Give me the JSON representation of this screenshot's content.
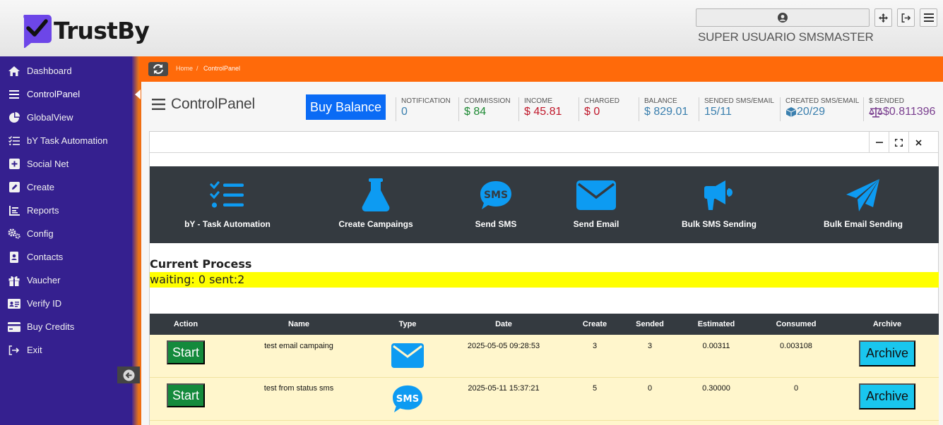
{
  "app": {
    "name": "TrustBy",
    "username": "SUPER USUARIO SMSMASTER"
  },
  "sidebar": {
    "items": [
      {
        "label": "Dashboard",
        "icon": "home-icon"
      },
      {
        "label": "ControlPanel",
        "icon": "bars-icon",
        "active": true
      },
      {
        "label": "GlobalView",
        "icon": "pie-chart-icon"
      },
      {
        "label": "bY Task Automation",
        "icon": "task-list-icon"
      },
      {
        "label": "Social Net",
        "icon": "plus-square-icon"
      },
      {
        "label": "Create",
        "icon": "edit-icon"
      },
      {
        "label": "Reports",
        "icon": "list-icon"
      },
      {
        "label": "Config",
        "icon": "gears-icon"
      },
      {
        "label": "Contacts",
        "icon": "address-book-icon"
      },
      {
        "label": "Vaucher",
        "icon": "gift-icon"
      },
      {
        "label": "Verify ID",
        "icon": "id-card-icon"
      },
      {
        "label": "Buy Credits",
        "icon": "credit-card-icon"
      },
      {
        "label": "Exit",
        "icon": "sign-out-icon"
      }
    ]
  },
  "breadcrumb": {
    "home": "Home",
    "separator": "/",
    "current": "ControlPanel"
  },
  "header": {
    "title": "ControlPanel",
    "buy_balance": "Buy Balance"
  },
  "stats": [
    {
      "label": "NOTIFICATION",
      "value": "0",
      "color": "#3a7fae"
    },
    {
      "label": "COMMISSION",
      "value": "$ 84",
      "color": "#1e8a34"
    },
    {
      "label": "INCOME",
      "value": "$ 45.81",
      "color": "#c0182b"
    },
    {
      "label": "CHARGED",
      "value": "$ 0",
      "color": "#c0182b"
    },
    {
      "label": "BALANCE",
      "value": "$ 829.01",
      "color": "#3a7fae"
    },
    {
      "label": "SENDED SMS/EMAIL",
      "value": "15/11",
      "color": "#3a7fae"
    },
    {
      "label": "CREATED SMS/EMAIL",
      "value": "20/29",
      "color": "#3a7fae"
    },
    {
      "label": "$ SENDED",
      "value": "$0.811396",
      "color": "#7a3f8f"
    }
  ],
  "actions": [
    {
      "label": "bY - Task Automation",
      "icon": "task-list-icon"
    },
    {
      "label": "Create Campaings",
      "icon": "flask-icon"
    },
    {
      "label": "Send SMS",
      "icon": "sms-icon"
    },
    {
      "label": "Send Email",
      "icon": "envelope-icon"
    },
    {
      "label": "Bulk SMS Sending",
      "icon": "megaphone-icon"
    },
    {
      "label": "Bulk Email Sending",
      "icon": "paper-plane-icon"
    }
  ],
  "process": {
    "title": "Current Process",
    "status": "waiting: 0 sent:2"
  },
  "table": {
    "columns": [
      "Action",
      "Name",
      "Type",
      "Date",
      "Create",
      "Sended",
      "Estimated",
      "Consumed",
      "Archive"
    ],
    "rows": [
      {
        "action": "Start",
        "name": "test email campaing",
        "type": "envelope-icon",
        "date": "2025-05-05 09:28:53",
        "create": "3",
        "sended": "3",
        "estimated": "0.00311",
        "consumed": "0.003108",
        "archive": "Archive"
      },
      {
        "action": "Start",
        "name": "test from status sms",
        "type": "sms-icon",
        "date": "2025-05-11 15:37:21",
        "create": "5",
        "sended": "0",
        "estimated": "0.30000",
        "consumed": "0",
        "archive": "Archive"
      }
    ]
  },
  "colors": {
    "sidebar": "#35208f",
    "orange": "#ff6a0a",
    "accent": "#0a6bf5",
    "icon_blue": "#0d9bf2",
    "highlight": "#ffff00"
  },
  "panel_controls": [
    "minimize-icon",
    "expand-icon",
    "close-icon"
  ]
}
